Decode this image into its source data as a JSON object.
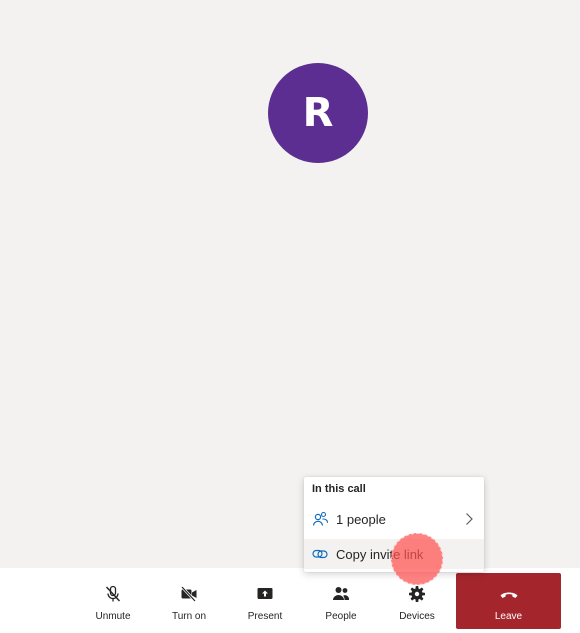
{
  "participant": {
    "initial": "R",
    "avatar_color": "#5c2e91"
  },
  "popup": {
    "title": "In this call",
    "people_label": "1 people",
    "invite_label": "Copy invite link",
    "accent_color": "#0f6cbd"
  },
  "toolbar": {
    "unmute_label": "Unmute",
    "camera_label": "Turn on",
    "present_label": "Present",
    "people_label": "People",
    "devices_label": "Devices",
    "leave_label": "Leave",
    "leave_color": "#a4262c"
  },
  "icons": {
    "unmute": "mic-off-icon",
    "camera": "camera-off-icon",
    "present": "present-icon",
    "people": "people-icon",
    "devices": "gear-icon",
    "leave": "hang-up-icon"
  }
}
